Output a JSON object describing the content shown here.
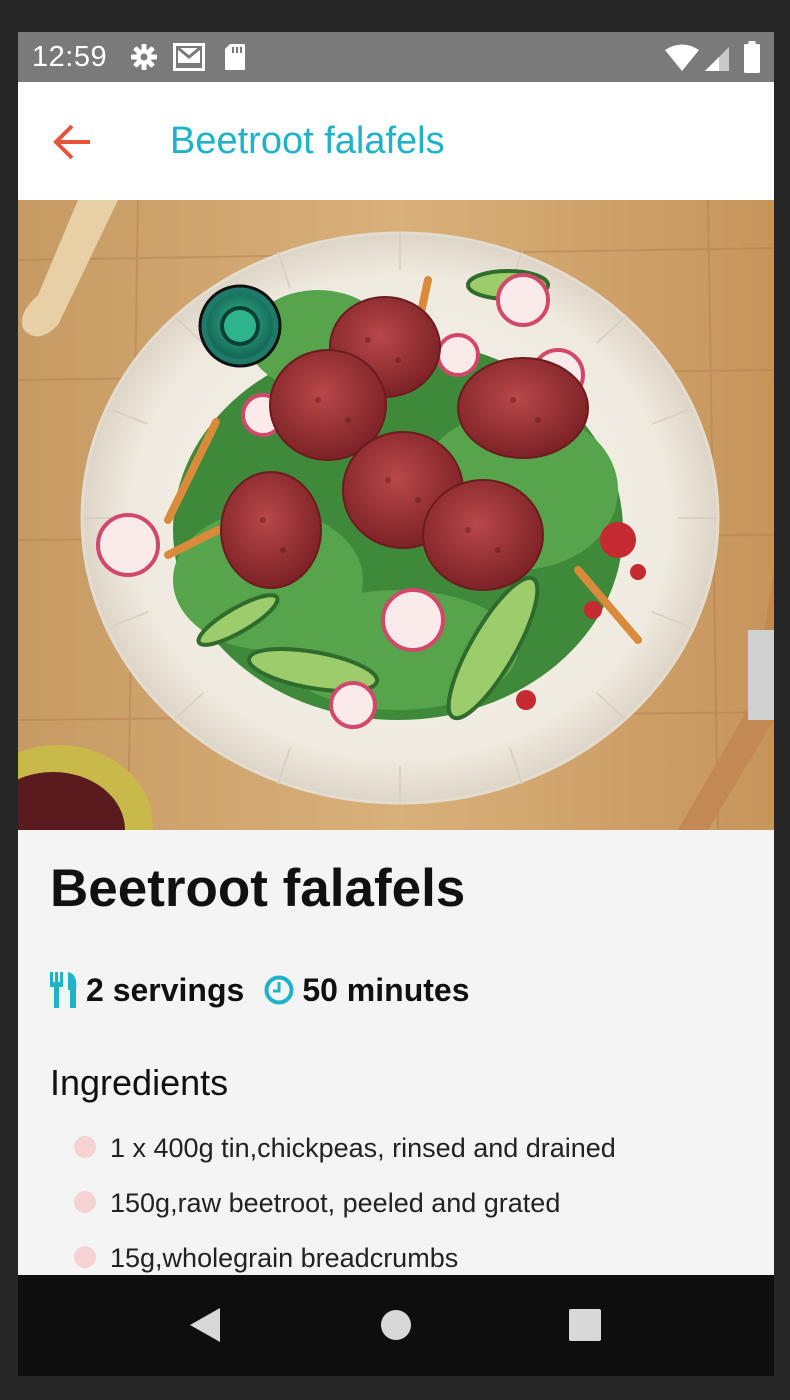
{
  "status_bar": {
    "time": "12:59",
    "icons": [
      "gear-icon",
      "gmail-icon",
      "sd-card-icon",
      "wifi-icon",
      "signal-icon",
      "battery-icon"
    ]
  },
  "app_bar": {
    "title": "Beetroot falafels",
    "back_icon": "arrow-left-icon",
    "accent_color": "#1fb3c9",
    "back_color": "#e8543a"
  },
  "recipe": {
    "title": "Beetroot falafels",
    "servings": "2 servings",
    "time": "50 minutes",
    "servings_icon": "cutlery-icon",
    "time_icon": "clock-icon",
    "ingredients_heading": "Ingredients",
    "ingredients": [
      "1 x 400g tin,chickpeas, rinsed and drained",
      "150g,raw beetroot, peeled and grated",
      "15g,wholegrain breadcrumbs"
    ]
  },
  "nav_bar": {
    "buttons": [
      "back-triangle-icon",
      "home-circle-icon",
      "recents-square-icon"
    ]
  }
}
